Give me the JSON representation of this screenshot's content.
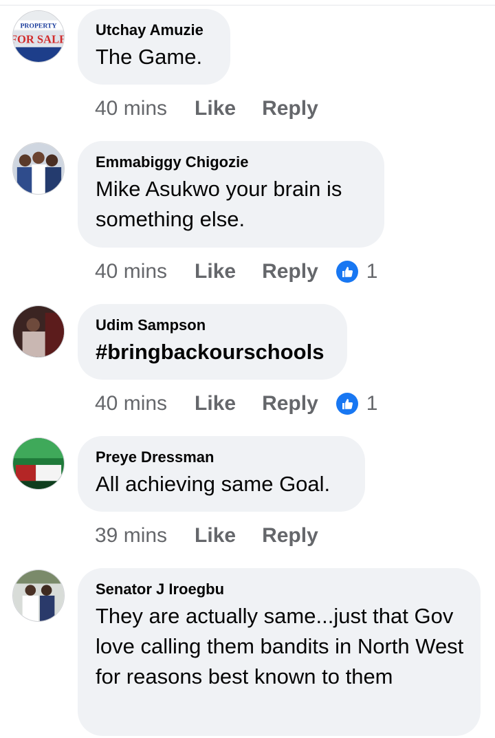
{
  "comments": [
    {
      "author": "Utchay Amuzie",
      "text": "The Game.",
      "time": "40 mins",
      "like_label": "Like",
      "reply_label": "Reply",
      "reactions": null,
      "avatar_sign_text_1": "PROPERTY",
      "avatar_sign_text_2": "FOR SALE"
    },
    {
      "author": "Emmabiggy Chigozie",
      "text": "Mike Asukwo your brain is something else.",
      "time": "40 mins",
      "like_label": "Like",
      "reply_label": "Reply",
      "reactions": "1"
    },
    {
      "author": "Udim Sampson",
      "text": "#bringbackourschools",
      "time": "40 mins",
      "like_label": "Like",
      "reply_label": "Reply",
      "reactions": "1"
    },
    {
      "author": "Preye Dressman",
      "text": "All achieving same Goal.",
      "time": "39 mins",
      "like_label": "Like",
      "reply_label": "Reply",
      "reactions": null
    },
    {
      "author": "Senator J Iroegbu",
      "text": "They are actually same...just that Gov love calling them bandits in North West for reasons best known to them",
      "time": "",
      "like_label": "",
      "reply_label": "",
      "reactions": null
    }
  ],
  "colors": {
    "bubble": "#f0f2f5",
    "meta_text": "#65676b",
    "like_blue": "#1877f2"
  },
  "icons": {
    "like_reaction": "thumbs-up-icon"
  }
}
